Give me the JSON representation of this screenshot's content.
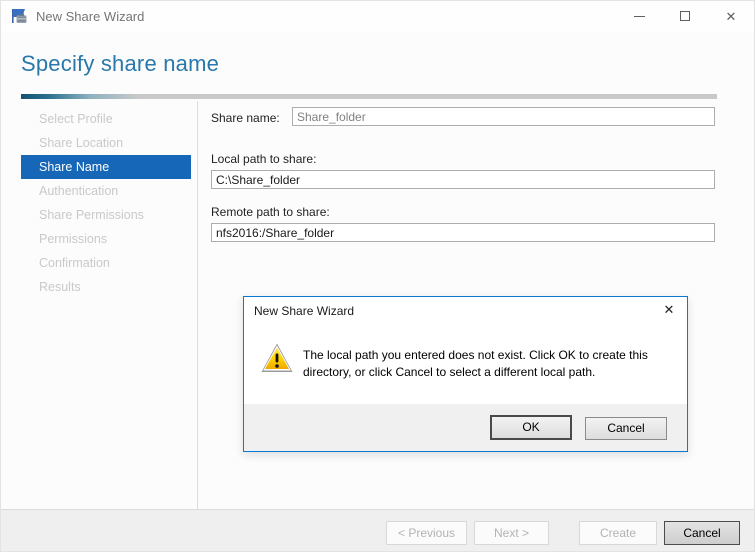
{
  "window": {
    "title": "New Share Wizard"
  },
  "header": {
    "title": "Specify share name"
  },
  "sidebar": {
    "items": [
      {
        "label": "Select Profile",
        "state": "disabled"
      },
      {
        "label": "Share Location",
        "state": "disabled"
      },
      {
        "label": "Share Name",
        "state": "selected"
      },
      {
        "label": "Authentication",
        "state": "disabled"
      },
      {
        "label": "Share Permissions",
        "state": "disabled"
      },
      {
        "label": "Permissions",
        "state": "disabled"
      },
      {
        "label": "Confirmation",
        "state": "disabled"
      },
      {
        "label": "Results",
        "state": "disabled"
      }
    ]
  },
  "form": {
    "share_name": {
      "label": "Share name:",
      "value": "Share_folder"
    },
    "local_path": {
      "label": "Local path to share:",
      "value": "C:\\Share_folder"
    },
    "remote_path": {
      "label": "Remote path to share:",
      "value": "nfs2016:/Share_folder"
    }
  },
  "dialog": {
    "title": "New Share Wizard",
    "message": "The local path you entered does not exist. Click OK to create this\ndirectory, or click Cancel to select a different local path.",
    "ok_label": "OK",
    "cancel_label": "Cancel"
  },
  "wizard_buttons": {
    "previous": "< Previous",
    "next": "Next >",
    "create": "Create",
    "cancel": "Cancel"
  },
  "icons": {
    "app": "server-manager",
    "minimize": "minimize-dash",
    "maximize": "maximize-square",
    "close": "✕",
    "dialog_close": "✕",
    "warning": "warning-triangle"
  },
  "colors": {
    "accent_blue": "#1667b8",
    "heading_blue": "#2878ab",
    "dialog_border": "#0979d2",
    "warning_yellow": "#ffd400",
    "footer_gray": "#efefef"
  }
}
